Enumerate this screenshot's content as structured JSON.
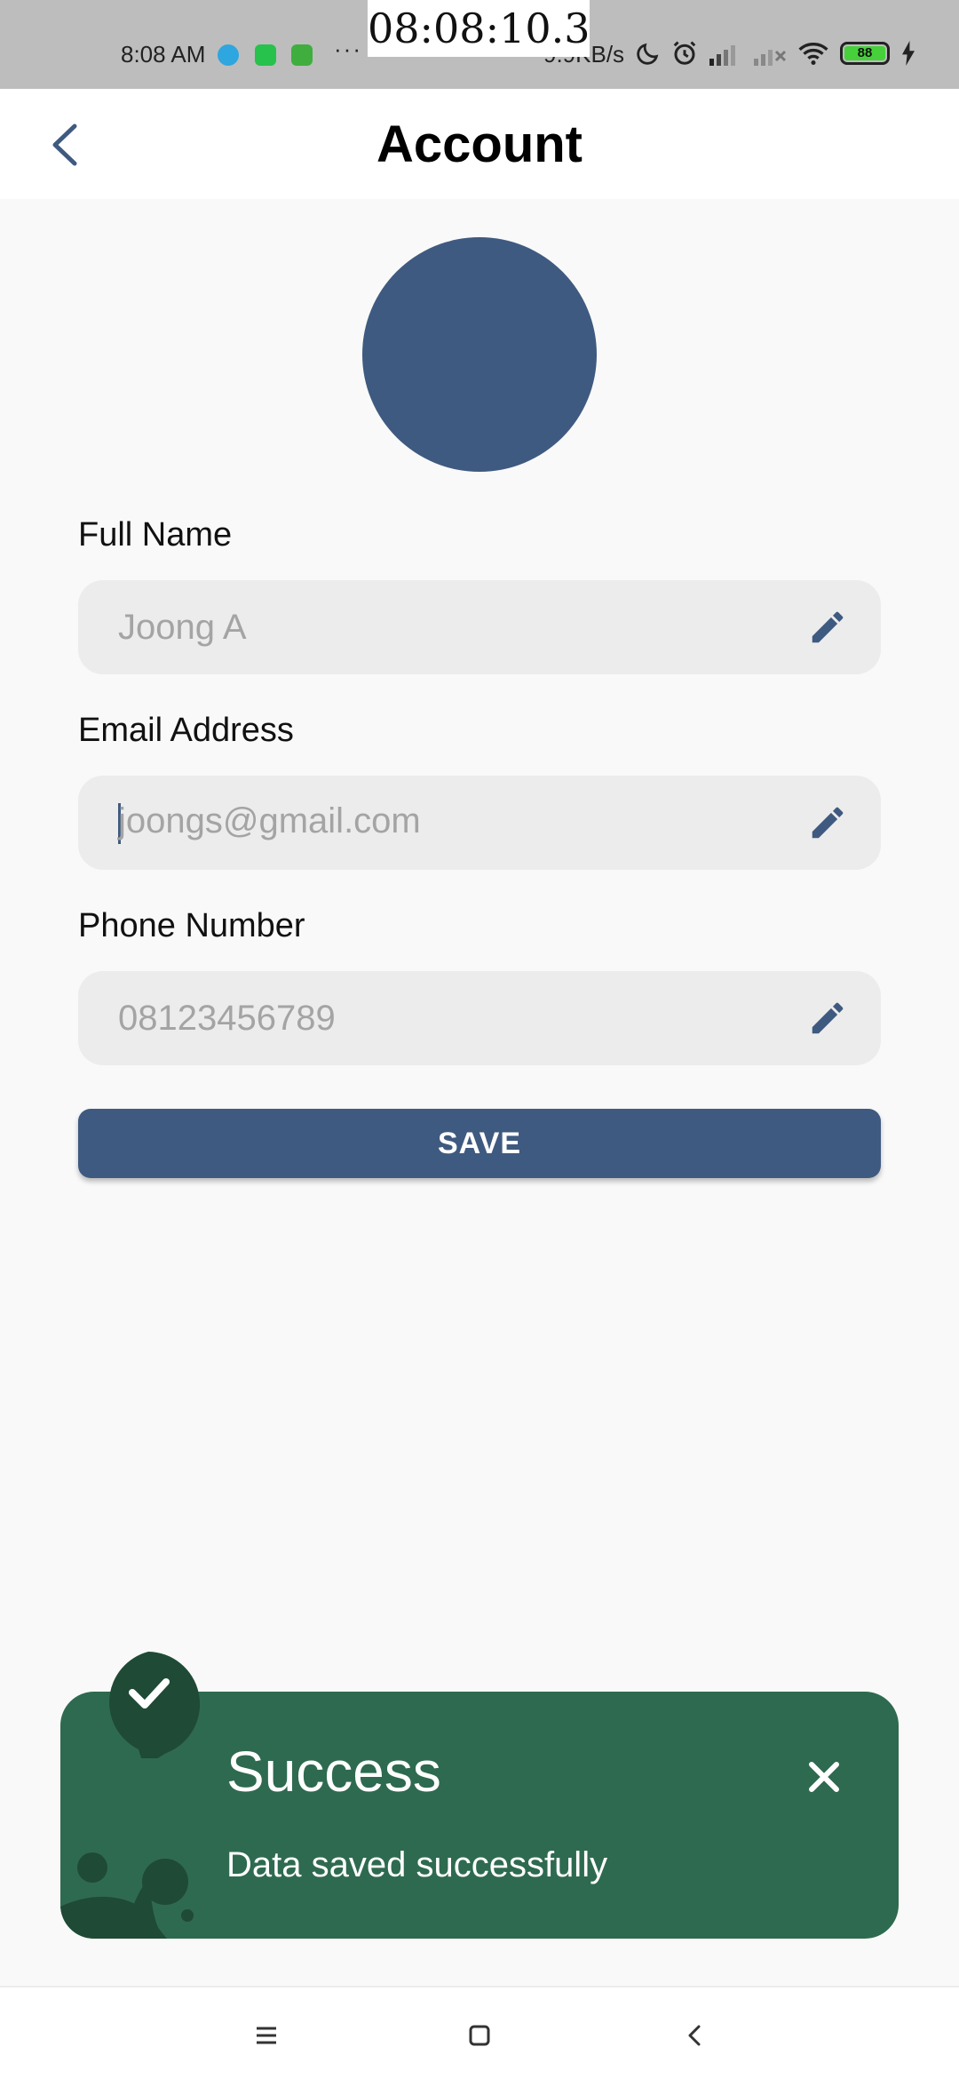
{
  "status_bar": {
    "time": "8:08 AM",
    "more": "···",
    "clock_overlay": "08:08:10.3",
    "net_speed": "9.9KB/s",
    "battery": "88",
    "icons": [
      "telegram-icon",
      "whatsapp-icon",
      "android-app-icon",
      "moon-icon",
      "alarm-icon",
      "signal-icon",
      "signal-none-icon",
      "wifi-icon",
      "battery-icon",
      "charging-icon"
    ]
  },
  "header": {
    "title": "Account",
    "back_icon": "chevron-left-icon"
  },
  "colors": {
    "primary": "#3f5a80",
    "success": "#2e6a4f",
    "success_dark": "#1f4a36",
    "field_bg": "#ececec",
    "page_bg": "#f9f9f9"
  },
  "form": {
    "full_name": {
      "label": "Full Name",
      "value": "Joong A"
    },
    "email": {
      "label": "Email Address",
      "value": "joongs@gmail.com"
    },
    "phone": {
      "label": "Phone Number",
      "value": "08123456789"
    },
    "edit_icon": "pencil-icon",
    "save_label": "SAVE"
  },
  "toast": {
    "title": "Success",
    "message": "Data saved successfully",
    "icons": [
      "check-icon",
      "close-icon"
    ]
  },
  "nav_bar": {
    "icons": [
      "menu-icon",
      "home-square-icon",
      "back-icon"
    ]
  }
}
